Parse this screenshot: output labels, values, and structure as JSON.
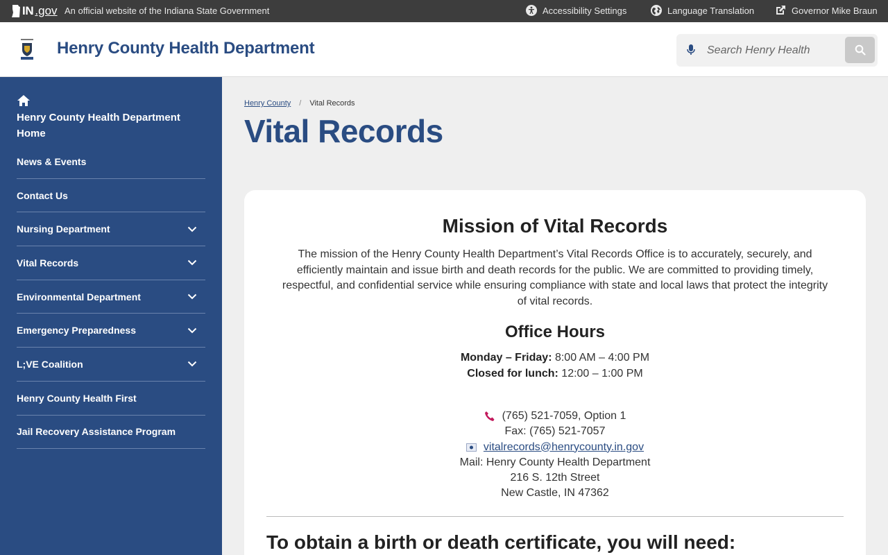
{
  "gov_bar": {
    "logo_in": "IN",
    "logo_gov": ".gov",
    "official_text": "An official website of the Indiana State Government",
    "links": [
      {
        "label": "Accessibility Settings",
        "icon": "accessibility-icon"
      },
      {
        "label": "Language Translation",
        "icon": "globe-icon"
      },
      {
        "label": "Governor Mike Braun",
        "icon": "external-link-icon"
      }
    ]
  },
  "header": {
    "site_title": "Henry County Health Department",
    "search_placeholder": "Search Henry Health"
  },
  "sidebar": {
    "home_label": "Henry County Health Department Home",
    "items": [
      {
        "label": "News & Events",
        "expandable": false
      },
      {
        "label": "Contact Us",
        "expandable": false
      },
      {
        "label": "Nursing Department",
        "expandable": true
      },
      {
        "label": "Vital Records",
        "expandable": true
      },
      {
        "label": "Environmental Department",
        "expandable": true
      },
      {
        "label": "Emergency Preparedness",
        "expandable": true
      },
      {
        "label": "L;VE Coalition",
        "expandable": true
      },
      {
        "label": "Henry County Health First",
        "expandable": false
      },
      {
        "label": "Jail Recovery Assistance Program",
        "expandable": false
      }
    ]
  },
  "breadcrumb": {
    "parent": "Henry County",
    "separator": "/",
    "current": "Vital Records"
  },
  "page_title": "Vital Records",
  "content": {
    "mission_heading": "Mission of Vital Records",
    "mission_text": "The mission of the Henry County Health Department’s Vital Records Office is to accurately, securely, and efficiently maintain and issue birth and death records for the public. We are committed to providing timely, respectful, and confidential service while ensuring compliance with state and local laws that protect the integrity of vital records.",
    "hours_heading": "Office Hours",
    "hours_weekday_label": "Monday – Friday:",
    "hours_weekday_value": " 8:00 AM – 4:00 PM",
    "hours_lunch_label": "Closed for lunch:",
    "hours_lunch_value": " 12:00 – 1:00 PM",
    "phone": "(765) 521-7059, Option 1",
    "fax": "Fax: (765) 521-7057",
    "email": "vitalrecords@henrycounty.in.gov",
    "mail_line1": "Mail: Henry County Health Department",
    "mail_line2": "216 S. 12th Street",
    "mail_line3": "New Castle, IN 47362",
    "obtain_heading": "To obtain a birth or death certificate, you will need:"
  },
  "colors": {
    "brand_blue": "#2a4c82",
    "gov_bar": "#3d3d3d",
    "phone_icon": "#c2185b"
  }
}
